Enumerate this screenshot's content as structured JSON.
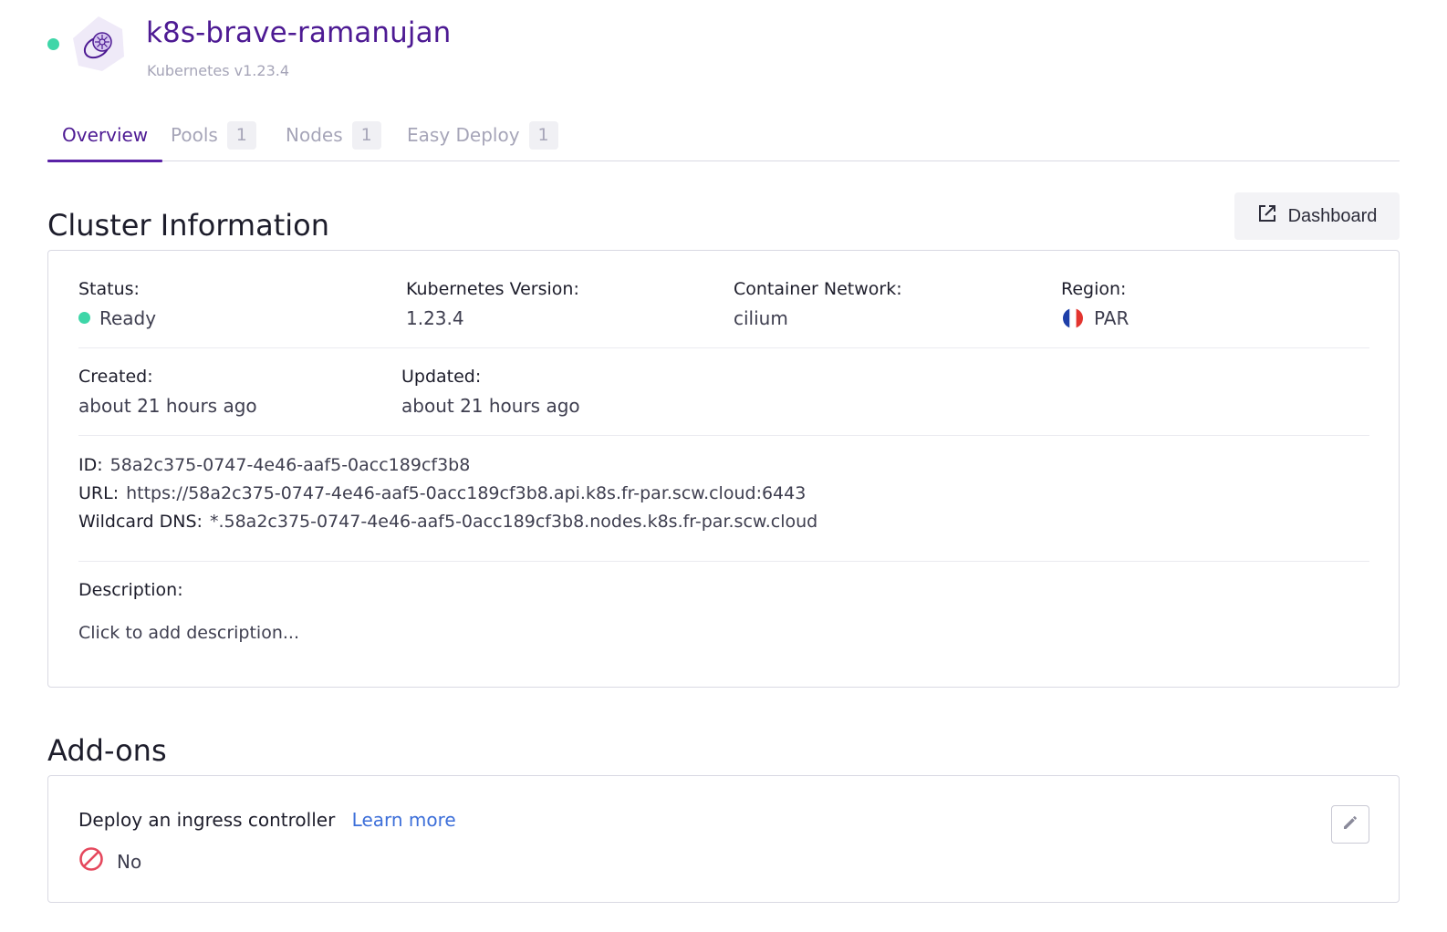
{
  "cluster": {
    "name": "k8s-brave-ramanujan",
    "subtitle": "Kubernetes v1.23.4"
  },
  "tabs": [
    {
      "label": "Overview",
      "count": null,
      "active": true
    },
    {
      "label": "Pools",
      "count": "1",
      "active": false
    },
    {
      "label": "Nodes",
      "count": "1",
      "active": false
    },
    {
      "label": "Easy Deploy",
      "count": "1",
      "active": false
    }
  ],
  "cluster_info": {
    "heading": "Cluster Information",
    "dashboard_label": "Dashboard",
    "status_label": "Status:",
    "status_value": "Ready",
    "version_label": "Kubernetes Version:",
    "version_value": "1.23.4",
    "network_label": "Container Network:",
    "network_value": "cilium",
    "region_label": "Region:",
    "region_value": "PAR",
    "created_label": "Created:",
    "created_value": "about 21 hours ago",
    "updated_label": "Updated:",
    "updated_value": "about 21 hours ago",
    "id_label": "ID:",
    "id_value": "58a2c375-0747-4e46-aaf5-0acc189cf3b8",
    "url_label": "URL:",
    "url_value": "https://58a2c375-0747-4e46-aaf5-0acc189cf3b8.api.k8s.fr-par.scw.cloud:6443",
    "dns_label": "Wildcard DNS:",
    "dns_value": "*.58a2c375-0747-4e46-aaf5-0acc189cf3b8.nodes.k8s.fr-par.scw.cloud",
    "description_label": "Description:",
    "description_placeholder": "Click to add description..."
  },
  "addons": {
    "heading": "Add-ons",
    "ingress_label": "Deploy an ingress controller",
    "learn_more": "Learn more",
    "ingress_value": "No"
  },
  "colors": {
    "accent": "#4d1a93",
    "status_ready": "#3ed6a8",
    "link": "#3d6fd9",
    "danger": "#e5485d"
  },
  "icons": {
    "logo": "kubernetes-logo-icon",
    "dashboard": "external-link-icon",
    "region": "france-flag-icon",
    "ingress_status": "forbidden-icon",
    "edit": "pencil-icon"
  }
}
